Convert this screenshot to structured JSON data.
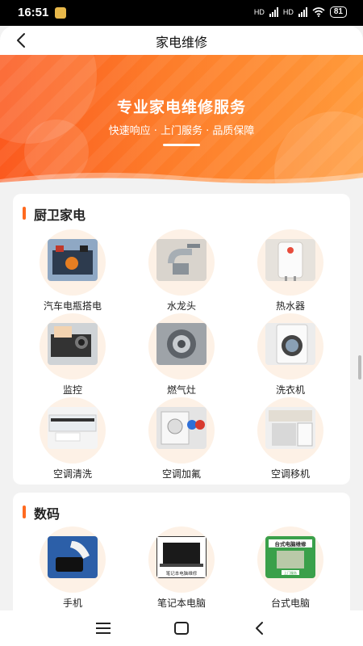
{
  "status_bar": {
    "time": "16:51",
    "battery": "81",
    "network_1": "HD",
    "network_2": "HD"
  },
  "header": {
    "title": "家电维修",
    "back_icon": "chevron-left-icon"
  },
  "banner": {
    "title": "专业家电维修服务",
    "subtitle": "快速响应 · 上门服务 · 品质保障",
    "colors": {
      "start": "#fb5a1f",
      "end": "#ff9a3a"
    }
  },
  "sections": [
    {
      "title": "厨卫家电",
      "items": [
        {
          "label": "汽车电瓶搭电",
          "icon": "car-battery-photo"
        },
        {
          "label": "水龙头",
          "icon": "faucet-photo"
        },
        {
          "label": "热水器",
          "icon": "water-heater-photo"
        },
        {
          "label": "监控",
          "icon": "camera-photo"
        },
        {
          "label": "燃气灶",
          "icon": "gas-stove-photo"
        },
        {
          "label": "洗衣机",
          "icon": "washing-machine-photo"
        },
        {
          "label": "空调清洗",
          "icon": "ac-cleaning-photo"
        },
        {
          "label": "空调加氟",
          "icon": "ac-refill-photo"
        },
        {
          "label": "空调移机",
          "icon": "ac-relocate-photo"
        }
      ]
    },
    {
      "title": "数码",
      "items": [
        {
          "label": "手机",
          "icon": "phone-repair-photo"
        },
        {
          "label": "笔记本电脑",
          "icon": "laptop-photo",
          "photo_caption": "笔记本电脑维修"
        },
        {
          "label": "台式电脑",
          "icon": "desktop-photo",
          "photo_caption": "台式电脑维修",
          "photo_footer": "上门服务"
        }
      ]
    }
  ],
  "accent_color": "#ff6a1f"
}
